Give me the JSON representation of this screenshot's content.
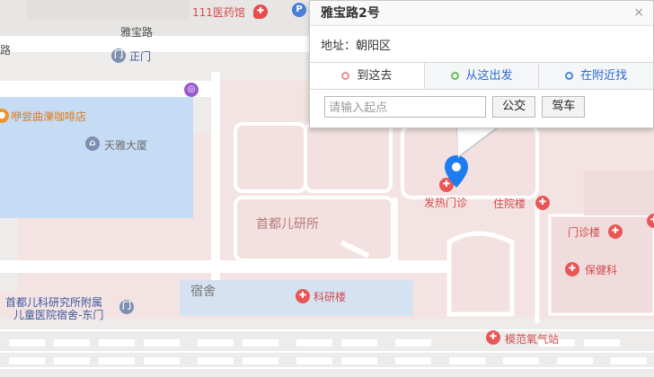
{
  "map": {
    "roads": {
      "yabao_road_top": "雅宝路",
      "yabao_road_left": "路"
    },
    "pois": {
      "pharmacy": "111医药馆",
      "zhengmen": "正门",
      "coffee": "咖啡店",
      "coffee_prefix": "咿尝曲濼咖啡店",
      "tianya": "天雅大厦",
      "institute": "首都儿研所",
      "fever_clinic": "发热门诊",
      "inpatient": "住院楼",
      "outpatient": "门诊楼",
      "health": "保健科",
      "research": "科研楼",
      "dorm": "宿舍",
      "dorm_gate_line1": "首都儿科研究所附属",
      "dorm_gate_line2": "儿童医院宿舍-东门",
      "oxygen": "模范氧气站"
    }
  },
  "popup": {
    "title": "雅宝路2号",
    "close_glyph": "×",
    "address_label": "地址：",
    "address_value": "朝阳区",
    "tabs": [
      {
        "label": "到这去"
      },
      {
        "label": "从这出发"
      },
      {
        "label": "在附近找"
      }
    ],
    "search": {
      "placeholder": "请输入起点",
      "value": ""
    },
    "buttons": {
      "transit": "公交",
      "drive": "驾车"
    }
  },
  "colors": {
    "hospital_pink": "#f4e3e3",
    "building_blue": "#c5dcf4",
    "road_white": "#ffffff",
    "marker_blue": "#1f7bf0",
    "tab_to_dot": "#e98c8c",
    "tab_from_dot": "#6cc05a",
    "tab_near_icon": "#4a86d8"
  },
  "icons": {
    "marker": "location-pin-icon",
    "hospital": "hospital-pin-icon",
    "close": "close-icon",
    "search": "search-nearby-icon"
  }
}
